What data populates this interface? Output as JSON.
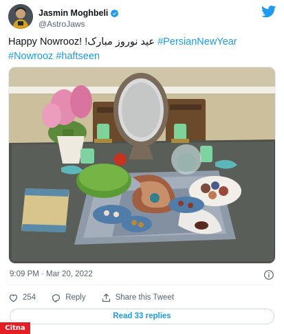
{
  "author": {
    "display_name": "Jasmin Moghbeli",
    "handle": "@AstroJaws",
    "verified": true
  },
  "tweet": {
    "text_plain": "Happy Nowrooz!",
    "text_persian": "عید نوروز مبارک!",
    "hashtags": [
      "#PersianNewYear",
      "#Nowrooz",
      "#haftseen"
    ]
  },
  "meta": {
    "timestamp": "9:09 PM · Mar 20, 2022"
  },
  "actions": {
    "like_count": "254",
    "reply_label": "Reply",
    "share_label": "Share this Tweet"
  },
  "read_replies": "Read 33 replies",
  "watermark": "Citna",
  "colors": {
    "accent": "#1d9bf0",
    "text": "#0f1419",
    "secondary": "#536471",
    "watermark_bg": "#e31e24"
  },
  "icons": [
    "verified-badge-icon",
    "twitter-bird-icon",
    "info-icon",
    "heart-icon",
    "reply-icon",
    "share-icon"
  ]
}
